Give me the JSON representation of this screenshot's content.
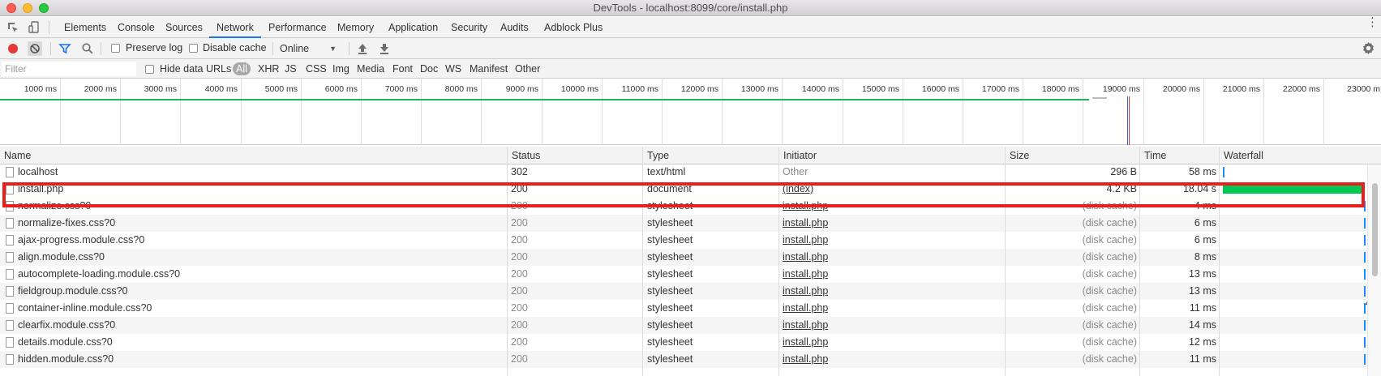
{
  "window": {
    "title": "DevTools - localhost:8099/core/install.php"
  },
  "tabs": [
    "Elements",
    "Console",
    "Sources",
    "Network",
    "Performance",
    "Memory",
    "Application",
    "Security",
    "Audits",
    "Adblock Plus"
  ],
  "active_tab": "Network",
  "toolbar": {
    "preserve_log": "Preserve log",
    "disable_cache": "Disable cache",
    "throttling": "Online"
  },
  "filterbar": {
    "placeholder": "Filter",
    "hide_data_urls": "Hide data URLs",
    "types": [
      "All",
      "XHR",
      "JS",
      "CSS",
      "Img",
      "Media",
      "Font",
      "Doc",
      "WS",
      "Manifest",
      "Other"
    ],
    "active_type": "All"
  },
  "overview": {
    "tick_labels": [
      "1000 ms",
      "2000 ms",
      "3000 ms",
      "4000 ms",
      "5000 ms",
      "6000 ms",
      "7000 ms",
      "8000 ms",
      "9000 ms",
      "10000 ms",
      "11000 ms",
      "12000 ms",
      "13000 ms",
      "14000 ms",
      "15000 ms",
      "16000 ms",
      "17000 ms",
      "18000 ms",
      "19000 ms",
      "20000 ms",
      "21000 ms",
      "22000 ms",
      "23000 m"
    ]
  },
  "table": {
    "columns": [
      "Name",
      "Status",
      "Type",
      "Initiator",
      "Size",
      "Time",
      "Waterfall"
    ],
    "rows": [
      {
        "name": "localhost",
        "status": "302",
        "type": "text/html",
        "initiator": "Other",
        "size": "296 B",
        "time": "58 ms"
      },
      {
        "name": "install.php",
        "status": "200",
        "type": "document",
        "initiator": "(index)",
        "size": "4.2 KB",
        "time": "18.04 s"
      },
      {
        "name": "normalize.css?0",
        "status": "200",
        "type": "stylesheet",
        "initiator": "install.php",
        "size": "(disk cache)",
        "time": "4 ms"
      },
      {
        "name": "normalize-fixes.css?0",
        "status": "200",
        "type": "stylesheet",
        "initiator": "install.php",
        "size": "(disk cache)",
        "time": "6 ms"
      },
      {
        "name": "ajax-progress.module.css?0",
        "status": "200",
        "type": "stylesheet",
        "initiator": "install.php",
        "size": "(disk cache)",
        "time": "6 ms"
      },
      {
        "name": "align.module.css?0",
        "status": "200",
        "type": "stylesheet",
        "initiator": "install.php",
        "size": "(disk cache)",
        "time": "8 ms"
      },
      {
        "name": "autocomplete-loading.module.css?0",
        "status": "200",
        "type": "stylesheet",
        "initiator": "install.php",
        "size": "(disk cache)",
        "time": "13 ms"
      },
      {
        "name": "fieldgroup.module.css?0",
        "status": "200",
        "type": "stylesheet",
        "initiator": "install.php",
        "size": "(disk cache)",
        "time": "13 ms"
      },
      {
        "name": "container-inline.module.css?0",
        "status": "200",
        "type": "stylesheet",
        "initiator": "install.php",
        "size": "(disk cache)",
        "time": "11 ms"
      },
      {
        "name": "clearfix.module.css?0",
        "status": "200",
        "type": "stylesheet",
        "initiator": "install.php",
        "size": "(disk cache)",
        "time": "14 ms"
      },
      {
        "name": "details.module.css?0",
        "status": "200",
        "type": "stylesheet",
        "initiator": "install.php",
        "size": "(disk cache)",
        "time": "12 ms"
      },
      {
        "name": "hidden.module.css?0",
        "status": "200",
        "type": "stylesheet",
        "initiator": "install.php",
        "size": "(disk cache)",
        "time": "11 ms"
      }
    ]
  },
  "colors": {
    "accent": "#1a73e8",
    "highlight": "#e8201c",
    "waterfall_green": "#00c853",
    "record": "#e53935"
  }
}
